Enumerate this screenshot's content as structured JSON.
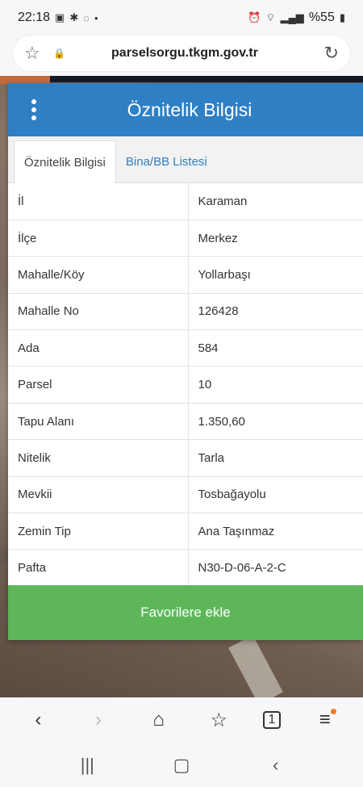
{
  "status_bar": {
    "time": "22:18",
    "left_icons": [
      "image-icon",
      "bluetooth-icon",
      "whatsapp-icon",
      "dot-icon"
    ],
    "battery": "%55"
  },
  "browser": {
    "url": "parselsorgu.tkgm.gov.tr"
  },
  "panel": {
    "title": "Öznitelik Bilgisi",
    "tabs": [
      {
        "label": "Öznitelik Bilgisi",
        "active": true
      },
      {
        "label": "Bina/BB Listesi",
        "active": false
      }
    ],
    "rows": [
      {
        "key": "İl",
        "value": "Karaman"
      },
      {
        "key": "İlçe",
        "value": "Merkez"
      },
      {
        "key": "Mahalle/Köy",
        "value": "Yollarbaşı"
      },
      {
        "key": "Mahalle No",
        "value": "126428"
      },
      {
        "key": "Ada",
        "value": "584"
      },
      {
        "key": "Parsel",
        "value": "10"
      },
      {
        "key": "Tapu Alanı",
        "value": "1.350,60"
      },
      {
        "key": "Nitelik",
        "value": "Tarla"
      },
      {
        "key": "Mevkii",
        "value": "Tosbağayolu"
      },
      {
        "key": "Zemin Tip",
        "value": "Ana Taşınmaz"
      },
      {
        "key": "Pafta",
        "value": "N30-D-06-A-2-C"
      }
    ],
    "favorite_label": "Favorilere ekle"
  },
  "colors": {
    "header": "#2f7fc4",
    "favorite": "#5db759"
  }
}
